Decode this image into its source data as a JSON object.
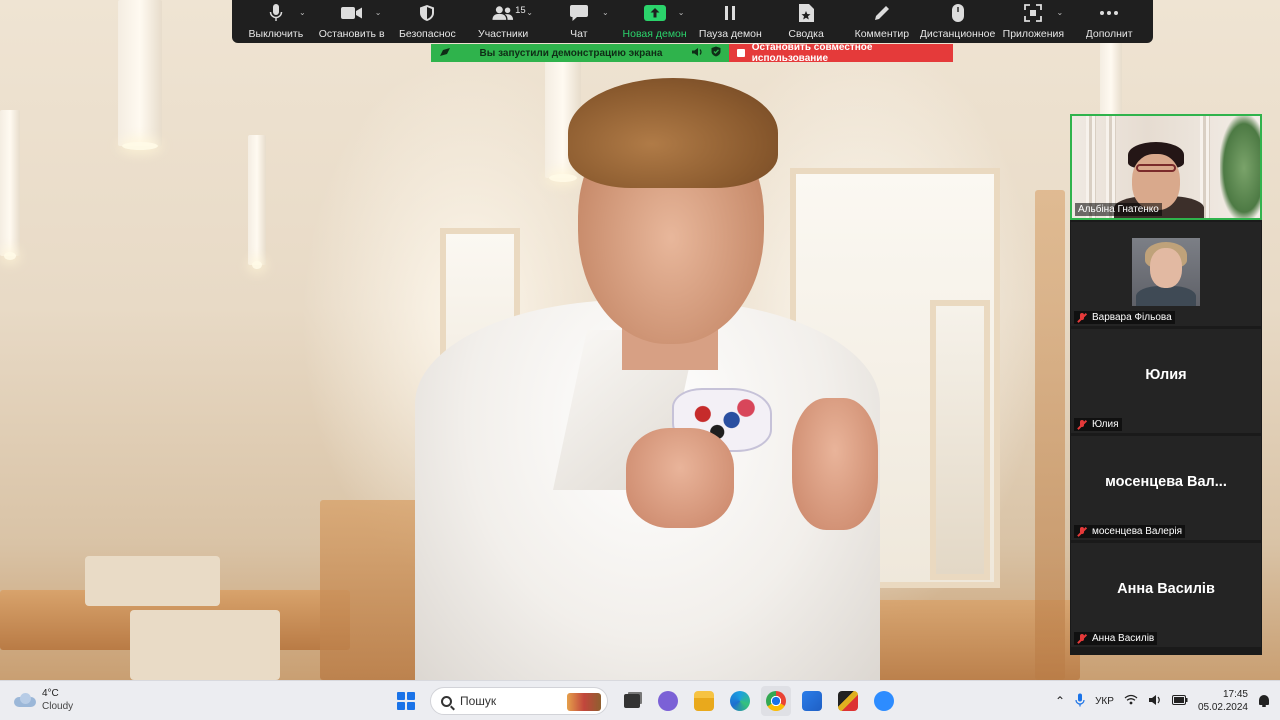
{
  "toolbar": {
    "items": [
      {
        "label": "Выключить",
        "icon": "microphone-icon",
        "caret": true
      },
      {
        "label": "Остановить в",
        "icon": "video-camera-icon",
        "caret": true
      },
      {
        "label": "Безопаснос",
        "icon": "shield-icon",
        "caret": false
      },
      {
        "label": "Участники",
        "icon": "participants-icon",
        "caret": true,
        "count": "15"
      },
      {
        "label": "Чат",
        "icon": "chat-icon",
        "caret": true
      },
      {
        "label": "Новая демон",
        "icon": "share-screen-icon",
        "caret": true,
        "accent": "#2bd36b"
      },
      {
        "label": "Пауза демон",
        "icon": "pause-icon",
        "caret": false
      },
      {
        "label": "Сводка",
        "icon": "summary-icon",
        "caret": false
      },
      {
        "label": "Комментир",
        "icon": "pencil-icon",
        "caret": false
      },
      {
        "label": "Дистанционное у",
        "icon": "mouse-icon",
        "caret": false
      },
      {
        "label": "Приложения",
        "icon": "apps-icon",
        "caret": true
      },
      {
        "label": "Дополнит",
        "icon": "more-icon",
        "caret": false
      }
    ]
  },
  "share_banner": {
    "text": "Вы запустили демонстрацию экрана",
    "stop_label": "Остановить совместное использование",
    "color": "#2fb34c",
    "stop_color": "#e53a3a"
  },
  "participants": [
    {
      "name": "Альбіна Гнатенко",
      "video": true,
      "muted": false,
      "active_speaker": true
    },
    {
      "name": "Варвара Фільова",
      "video": "avatar",
      "muted": true
    },
    {
      "name": "Юлия",
      "display": "Юлия",
      "muted": true
    },
    {
      "name": "мосенцева Валерія",
      "display": "мосенцева Вал...",
      "muted": true
    },
    {
      "name": "Анна Василів",
      "display": "Анна Василів",
      "muted": true
    }
  ],
  "taskbar": {
    "weather": {
      "temp": "4°C",
      "condition": "Cloudy"
    },
    "search_placeholder": "Пошук",
    "language": "УКР",
    "time": "17:45",
    "date": "05.02.2024"
  }
}
